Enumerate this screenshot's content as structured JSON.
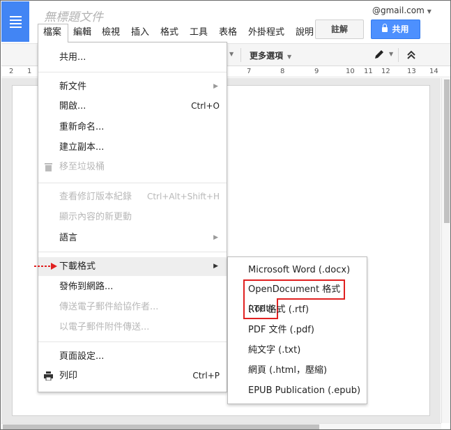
{
  "header": {
    "doc_title": "無標題文件",
    "account": "@gmail.com",
    "comment_button": "註解",
    "share_button": "共用"
  },
  "menubar": [
    "檔案",
    "編輯",
    "檢視",
    "插入",
    "格式",
    "工具",
    "表格",
    "外掛程式",
    "說明"
  ],
  "toolbar": {
    "more_options": "更多選項"
  },
  "ruler": {
    "ticks": [
      "2",
      "1",
      "7",
      "8",
      "9",
      "10",
      "11",
      "12",
      "13",
      "14"
    ]
  },
  "file_menu": {
    "share": "共用...",
    "new": "新文件",
    "open": "開啟...",
    "open_shortcut": "Ctrl+O",
    "rename": "重新命名...",
    "make_copy": "建立副本...",
    "move_to_trash": "移至垃圾桶",
    "revision_history": "查看修訂版本紀錄",
    "revision_history_shortcut": "Ctrl+Alt+Shift+H",
    "see_new_changes": "顯示內容的新更動",
    "language": "語言",
    "download_as": "下載格式",
    "publish_to_web": "發佈到網路...",
    "email_collaborators": "傳送電子郵件給協作者...",
    "email_as_attachment": "以電子郵件附件傳送...",
    "page_setup": "頁面設定...",
    "print": "列印",
    "print_shortcut": "Ctrl+P"
  },
  "download_submenu": [
    "Microsoft Word (.docx)",
    "OpenDocument 格式 (.odt)",
    "RTF 格式 (.rtf)",
    "PDF 文件 (.pdf)",
    "純文字 (.txt)",
    "網頁 (.html，壓縮)",
    "EPUB Publication (.epub)"
  ],
  "colors": {
    "brand_blue": "#4285f4",
    "share_blue": "#4d90fe",
    "highlight_box": "#e02020"
  }
}
